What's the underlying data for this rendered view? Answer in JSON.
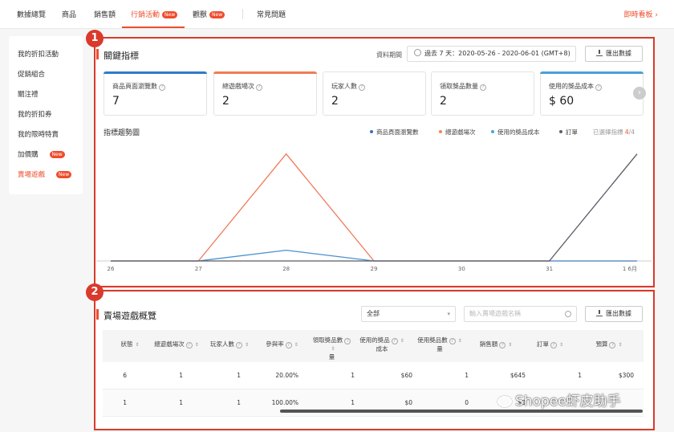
{
  "topnav": {
    "items": [
      "數據總覽",
      "商品",
      "銷售額",
      "行銷活動",
      "觀獸",
      "常見問題"
    ],
    "badge_new": "New",
    "right_link": "即時看板"
  },
  "sidebar": {
    "items": [
      "我的折扣活動",
      "促銷組合",
      "關注禮",
      "我的折扣券",
      "我的限時特賣",
      "加價購",
      "賣場遊戲"
    ],
    "badge_new": "New"
  },
  "markers": [
    "1",
    "2"
  ],
  "key_metrics": {
    "title": "關鍵指標",
    "period_label": "資料期間",
    "period_value": "過去 7 天：2020-05-26 - 2020-06-01 (GMT+8)",
    "export_label": "匯出數據",
    "cards": [
      {
        "label": "商品頁面瀏覽數",
        "value": "7",
        "color": "#2f7bc8"
      },
      {
        "label": "總遊戲場次",
        "value": "2",
        "color": "#ee7d55"
      },
      {
        "label": "玩家人數",
        "value": "2",
        "color": ""
      },
      {
        "label": "領取獎品數量",
        "value": "2",
        "color": ""
      },
      {
        "label": "使用的獎品成本",
        "value": "$ 60",
        "color": "#4a9fd8"
      }
    ],
    "arrow": "›"
  },
  "trend": {
    "title": "指標趨勢圖",
    "legend": [
      {
        "name": "商品頁面瀏覽數",
        "color": "#3b6fc4"
      },
      {
        "name": "總遊戲場次",
        "color": "#f08a4b"
      },
      {
        "name": "使用的獎品成本",
        "color": "#4aa3df"
      },
      {
        "name": "訂單",
        "color": "#5a5f6e"
      }
    ],
    "selected_label": "已選擇指標",
    "selected_count": "4",
    "selected_total": "/4"
  },
  "chart_data": {
    "type": "line",
    "x": [
      "26",
      "27",
      "28",
      "29",
      "30",
      "31",
      "1 6月"
    ],
    "series": [
      {
        "name": "總遊戲場次",
        "color": "#f07a5a",
        "values": [
          0,
          0,
          2,
          0,
          0,
          0,
          0
        ]
      },
      {
        "name": "使用的獎品成本",
        "color": "#4a90d0",
        "values": [
          0,
          0,
          0.2,
          0,
          0,
          0,
          0
        ]
      },
      {
        "name": "訂單",
        "color": "#5a5a66",
        "values": [
          0,
          0,
          0,
          0,
          0,
          0,
          2
        ]
      }
    ],
    "ylim": [
      0,
      2.1
    ],
    "grid": false
  },
  "games": {
    "title": "賣場遊戲概覽",
    "filter_value": "全部",
    "search_placeholder": "輸入賣場遊戲名稱",
    "export_label": "匯出數據",
    "headers": [
      "狀態",
      "總遊戲場次",
      "玩家人數",
      "參與率",
      "領取獎品數量",
      "使用的獎品成本",
      "使用獎品數量",
      "銷售額",
      "訂單",
      "預算"
    ],
    "header_lines": [
      [
        "狀態",
        ""
      ],
      [
        "總遊戲場次",
        ""
      ],
      [
        "玩家人數",
        ""
      ],
      [
        "參與率",
        ""
      ],
      [
        "領取獎品數",
        "量"
      ],
      [
        "使用的獎品",
        "成本"
      ],
      [
        "使用獎品數",
        "量"
      ],
      [
        "銷售額",
        ""
      ],
      [
        "訂單",
        ""
      ],
      [
        "預算",
        ""
      ]
    ],
    "rows": [
      [
        "6",
        "1",
        "1",
        "20.00%",
        "1",
        "$60",
        "1",
        "$645",
        "1",
        "$300"
      ],
      [
        "1",
        "1",
        "1",
        "100.00%",
        "1",
        "$0",
        "0",
        "$0",
        "",
        ""
      ]
    ]
  },
  "watermark": "Shopee虾皮助手"
}
